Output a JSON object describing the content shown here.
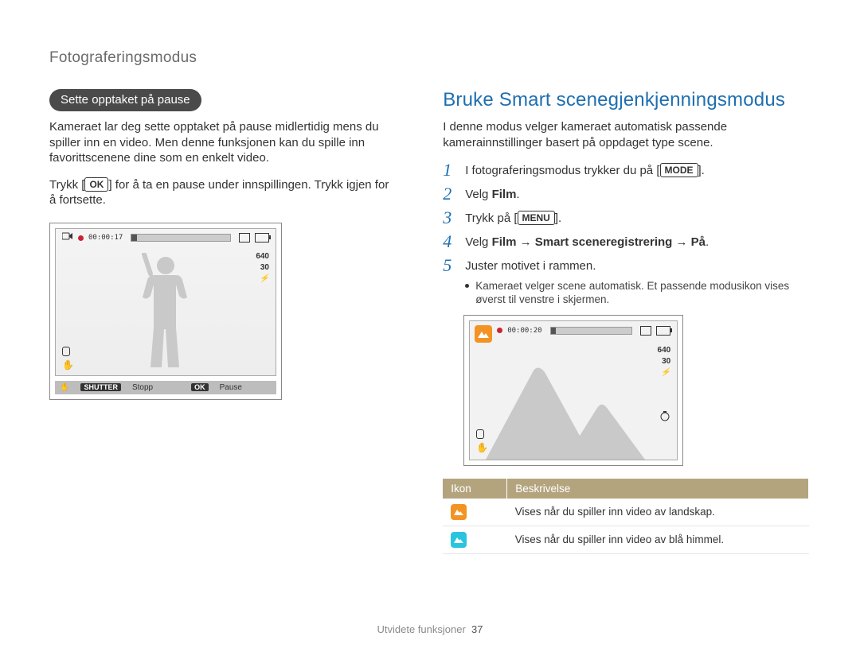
{
  "header": "Fotograferingsmodus",
  "left": {
    "pill": "Sette opptaket på pause",
    "p1": "Kameraet lar deg sette opptaket på pause midlertidig mens du spiller inn en video. Men denne funksjonen kan du spille inn favorittscenene dine som en enkelt video.",
    "p2_pre": "Trykk [",
    "p2_key": "OK",
    "p2_post": "] for å ta en pause under innspillingen. Trykk igjen for å fortsette.",
    "lcd": {
      "time": "00:00:17",
      "res": "640",
      "fps": "30",
      "footer_shutter_key": "SHUTTER",
      "footer_shutter": "Stopp",
      "footer_ok_key": "OK",
      "footer_ok": "Pause"
    }
  },
  "right": {
    "title": "Bruke Smart scenegjenkjenningsmodus",
    "intro": "I denne modus velger kameraet automatisk passende kamerainnstillinger basert på oppdaget type scene.",
    "steps": [
      {
        "n": "1",
        "pre": "I fotograferingsmodus trykker du på [",
        "key": "MODE",
        "post": "]."
      },
      {
        "n": "2",
        "pre": "Velg ",
        "bold": "Film",
        "post": "."
      },
      {
        "n": "3",
        "pre": "Trykk på [",
        "key": "MENU",
        "post": "]."
      },
      {
        "n": "4",
        "pre": "Velg ",
        "bold": "Film → Smart sceneregistrering → På",
        "post": "."
      },
      {
        "n": "5",
        "pre": "Juster motivet i rammen.",
        "bullet": "Kameraet velger scene automatisk. Et passende modusikon vises øverst til venstre i skjermen."
      }
    ],
    "lcd": {
      "time": "00:00:20",
      "res": "640",
      "fps": "30"
    },
    "table": {
      "h1": "Ikon",
      "h2": "Beskrivelse",
      "rows": [
        {
          "color": "orange",
          "text": "Vises når du spiller inn video av landskap."
        },
        {
          "color": "cyan",
          "text": "Vises når du spiller inn video av blå himmel."
        }
      ]
    }
  },
  "footer": {
    "label": "Utvidete funksjoner",
    "page": "37"
  }
}
